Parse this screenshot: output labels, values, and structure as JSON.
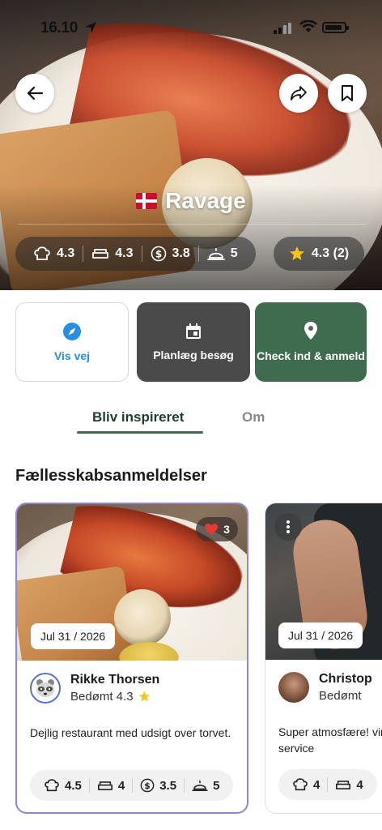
{
  "status_bar": {
    "time": "16.10"
  },
  "header": {
    "title": "Ravage",
    "ratings": {
      "food": "4.3",
      "ambience": "4.3",
      "price": "3.8",
      "service": "5"
    },
    "overall": "4.3 (2)"
  },
  "actions": {
    "directions": "Vis vej",
    "plan_visit": "Planlæg besøg",
    "checkin": "Check ind & anmeld"
  },
  "tabs": [
    {
      "label": "Bliv inspireret",
      "active": true
    },
    {
      "label": "Om",
      "active": false
    }
  ],
  "section_title": "Fællesskabsanmeldelser",
  "reviews": [
    {
      "likes": "3",
      "date": "Jul 31 / 2026",
      "name": "Rikke Thorsen",
      "rated": "Bedømt 4.3",
      "text": "Dejlig restaurant med udsigt over torvet.",
      "ratings": {
        "food": "4.5",
        "ambience": "4",
        "price": "3.5",
        "service": "5"
      }
    },
    {
      "date": "Jul 31 / 2026",
      "name": "Christop",
      "rated": "Bedømt",
      "text": "Super atmosfære! vin, kanon service",
      "ratings": {
        "food": "4",
        "ambience": "4"
      }
    }
  ],
  "colors": {
    "accent_green": "#3f6b4f",
    "link_blue": "#2a8ee0",
    "card_highlight": "#8f86d8",
    "star": "#f5c518",
    "heart": "#e53935"
  }
}
